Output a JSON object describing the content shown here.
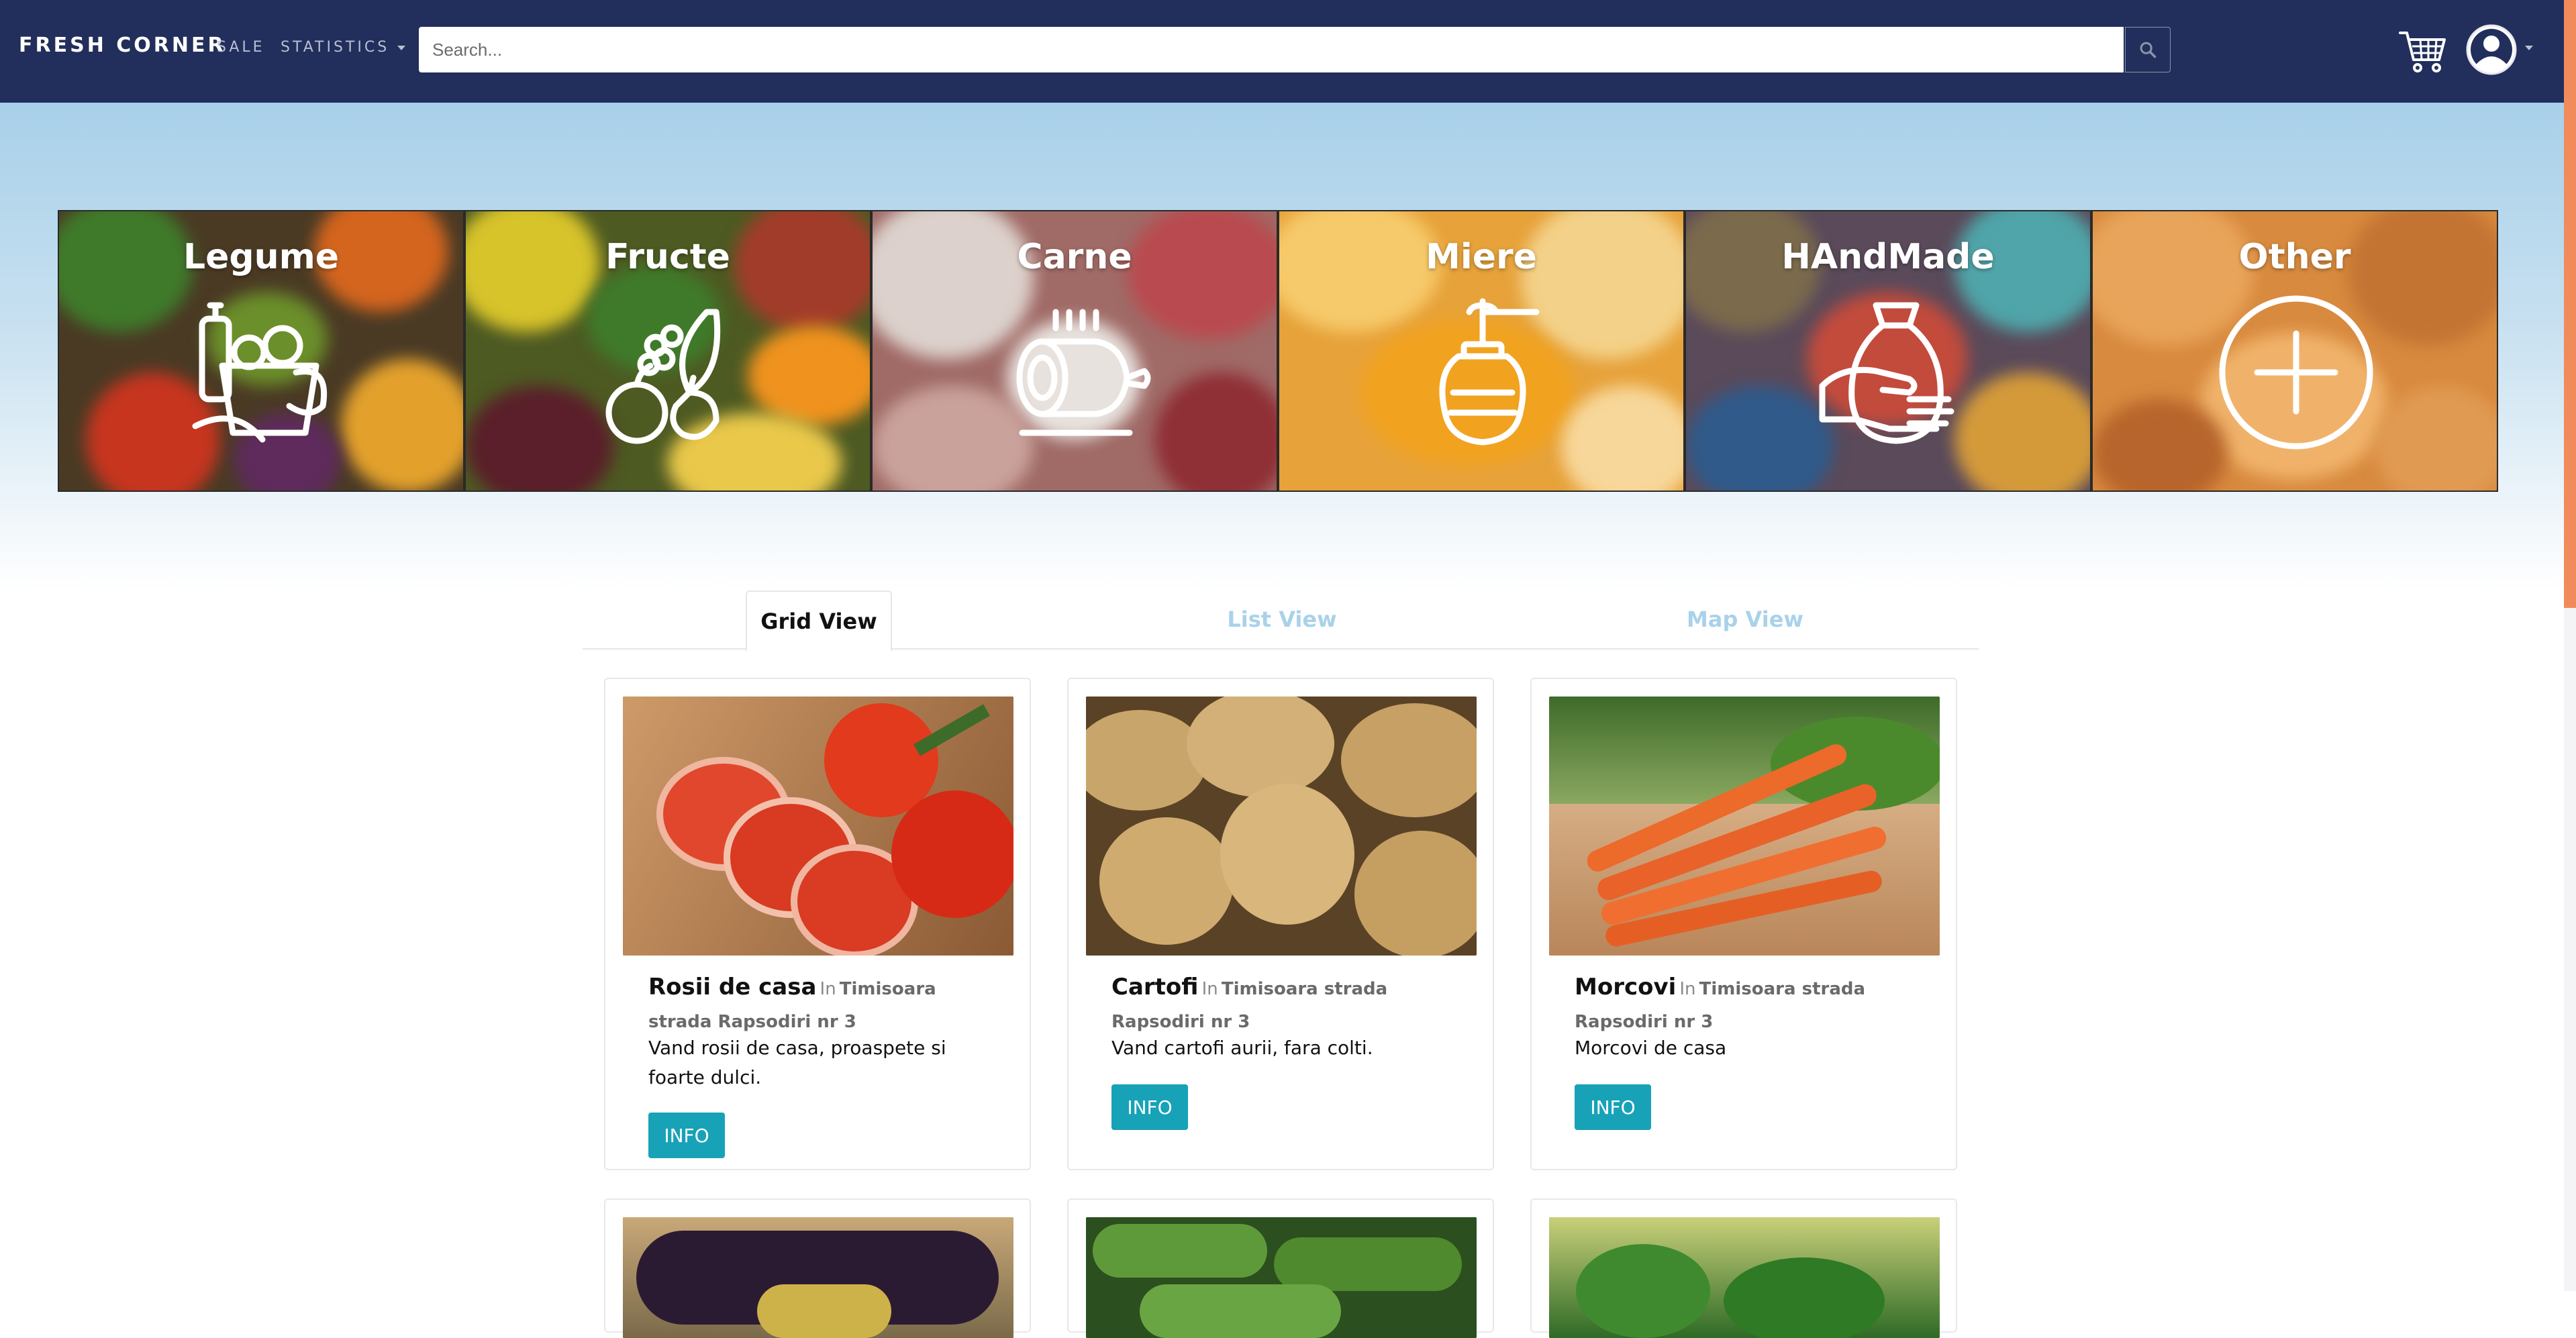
{
  "navbar": {
    "brand": "FRESH CORNER",
    "links": {
      "sale": "SALE",
      "statistics": "STATISTICS"
    },
    "search": {
      "placeholder": "Search...",
      "value": ""
    },
    "icons": {
      "search": "search-icon",
      "cart": "cart-icon",
      "account": "user-avatar-icon"
    }
  },
  "categories": [
    {
      "label": "Legume",
      "icon": "vegetables-basket-icon"
    },
    {
      "label": "Fructe",
      "icon": "fruits-icon"
    },
    {
      "label": "Carne",
      "icon": "ham-icon"
    },
    {
      "label": "Miere",
      "icon": "honey-jar-icon"
    },
    {
      "label": "HAndMade",
      "icon": "handmade-vase-icon"
    },
    {
      "label": "Other",
      "icon": "plus-circle-icon"
    }
  ],
  "tabs": {
    "grid": "Grid View",
    "list": "List View",
    "map": "Map View",
    "active": "grid"
  },
  "products": [
    {
      "name": "Rosii de casa",
      "location_prefix": "In",
      "location": "Timisoara strada Rapsodiri nr 3",
      "description": "Vand rosii de casa, proaspete si foarte dulci.",
      "button": "INFO",
      "image": "tomatoes"
    },
    {
      "name": "Cartofi",
      "location_prefix": "In",
      "location": "Timisoara strada Rapsodiri nr 3",
      "description": "Vand cartofi aurii, fara colti.",
      "button": "INFO",
      "image": "potatoes"
    },
    {
      "name": "Morcovi",
      "location_prefix": "In",
      "location": "Timisoara strada Rapsodiri nr 3",
      "description": "Morcovi de casa",
      "button": "INFO",
      "image": "carrots"
    }
  ],
  "partial_products": [
    {
      "image": "eggplants"
    },
    {
      "image": "cucumbers"
    },
    {
      "image": "greens"
    }
  ],
  "colors": {
    "navbar": "#222e5b",
    "accent_button": "#17a2b8",
    "inactive_tab": "#a9d2ea",
    "scrollbar": "#f28b5c"
  }
}
